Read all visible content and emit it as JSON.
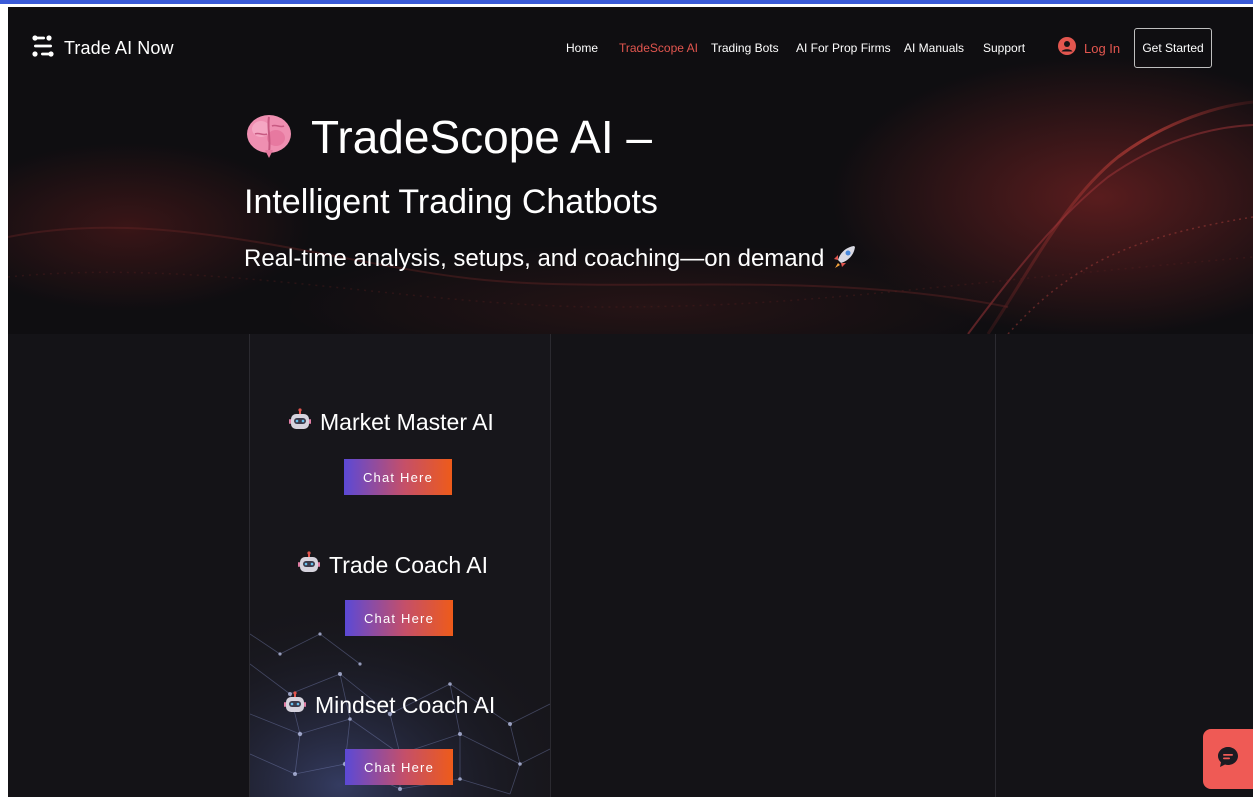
{
  "brand": {
    "name": "Trade AI Now",
    "icon": "logo-icon"
  },
  "nav": {
    "items": [
      {
        "label": "Home",
        "active": false
      },
      {
        "label": "TradeScope AI",
        "active": true
      },
      {
        "label": "Trading Bots",
        "active": false
      },
      {
        "label": "AI For Prop Firms",
        "active": false
      },
      {
        "label": "AI Manuals",
        "active": false
      },
      {
        "label": "Support",
        "active": false
      }
    ],
    "login_label": "Log In",
    "cta_label": "Get Started"
  },
  "hero": {
    "title": "TradeScope AI –",
    "subtitle": "Intelligent Trading Chatbots",
    "tagline": "Real-time analysis, setups, and coaching—on demand",
    "title_icon": "brain-icon",
    "tagline_icon": "rocket-icon"
  },
  "bots": [
    {
      "name": "Market Master AI",
      "button": "Chat Here",
      "icon": "robot-icon"
    },
    {
      "name": "Trade Coach AI",
      "button": "Chat Here",
      "icon": "robot-icon"
    },
    {
      "name": "Mindset Coach AI",
      "button": "Chat Here",
      "icon": "robot-icon"
    }
  ],
  "colors": {
    "background": "#141317",
    "accent": "#e2564f",
    "button_gradient": [
      "#5b49d6",
      "#ee5b1a"
    ],
    "chat_widget": "#ef5a55"
  }
}
